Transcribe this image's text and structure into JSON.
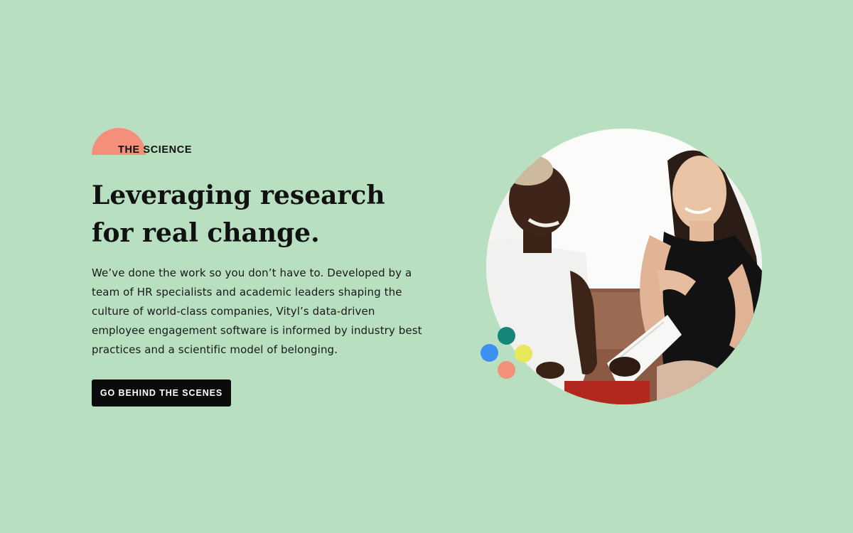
{
  "section": {
    "eyebrow": "THE SCIENCE",
    "headline_line1": "Leveraging research",
    "headline_line2": "for real change.",
    "body": "We’ve done the work so you don’t have to. Developed by a team of HR specialists and academic leaders shaping the culture of world-class companies, Vityl’s data-driven employee engagement software is informed by industry best practices and a scientific model of belonging.",
    "cta_label": "GO BEHIND THE SCENES"
  },
  "colors": {
    "background": "#b7dfc0",
    "accent_coral": "#f4907a",
    "button": "#0b0b0b",
    "dot_teal": "#16857a",
    "dot_blue": "#3d8ff0",
    "dot_yellow": "#e8e85a",
    "dot_coral": "#f4907a"
  },
  "image": {
    "subject": "two women smiling while reviewing a document"
  }
}
